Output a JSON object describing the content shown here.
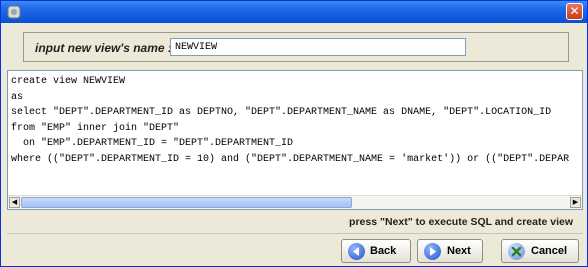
{
  "window": {
    "close_glyph": "✕"
  },
  "name_panel": {
    "label": "input new view's name :",
    "value": "NEWVIEW"
  },
  "sql_editor": {
    "text": "create view NEWVIEW\nas\nselect \"DEPT\".DEPARTMENT_ID as DEPTNO, \"DEPT\".DEPARTMENT_NAME as DNAME, \"DEPT\".LOCATION_ID\nfrom \"EMP\" inner join \"DEPT\"\n  on \"EMP\".DEPARTMENT_ID = \"DEPT\".DEPARTMENT_ID\nwhere ((\"DEPT\".DEPARTMENT_ID = 10) and (\"DEPT\".DEPARTMENT_NAME = 'market')) or ((\"DEPT\".DEPAR",
    "scroll_left_glyph": "◀",
    "scroll_right_glyph": "▶"
  },
  "hint": "press \"Next\" to execute SQL and create view",
  "buttons": {
    "back_label": "Back",
    "next_label": "Next",
    "cancel_label": "Cancel"
  },
  "icons": {
    "app": "app-icon",
    "back": "back-arrow-icon",
    "next": "next-arrow-icon",
    "cancel": "cancel-x-icon"
  },
  "colors": {
    "titlebar": "#1f6ae8",
    "close": "#c73b1c",
    "background": "#ece9d8"
  }
}
